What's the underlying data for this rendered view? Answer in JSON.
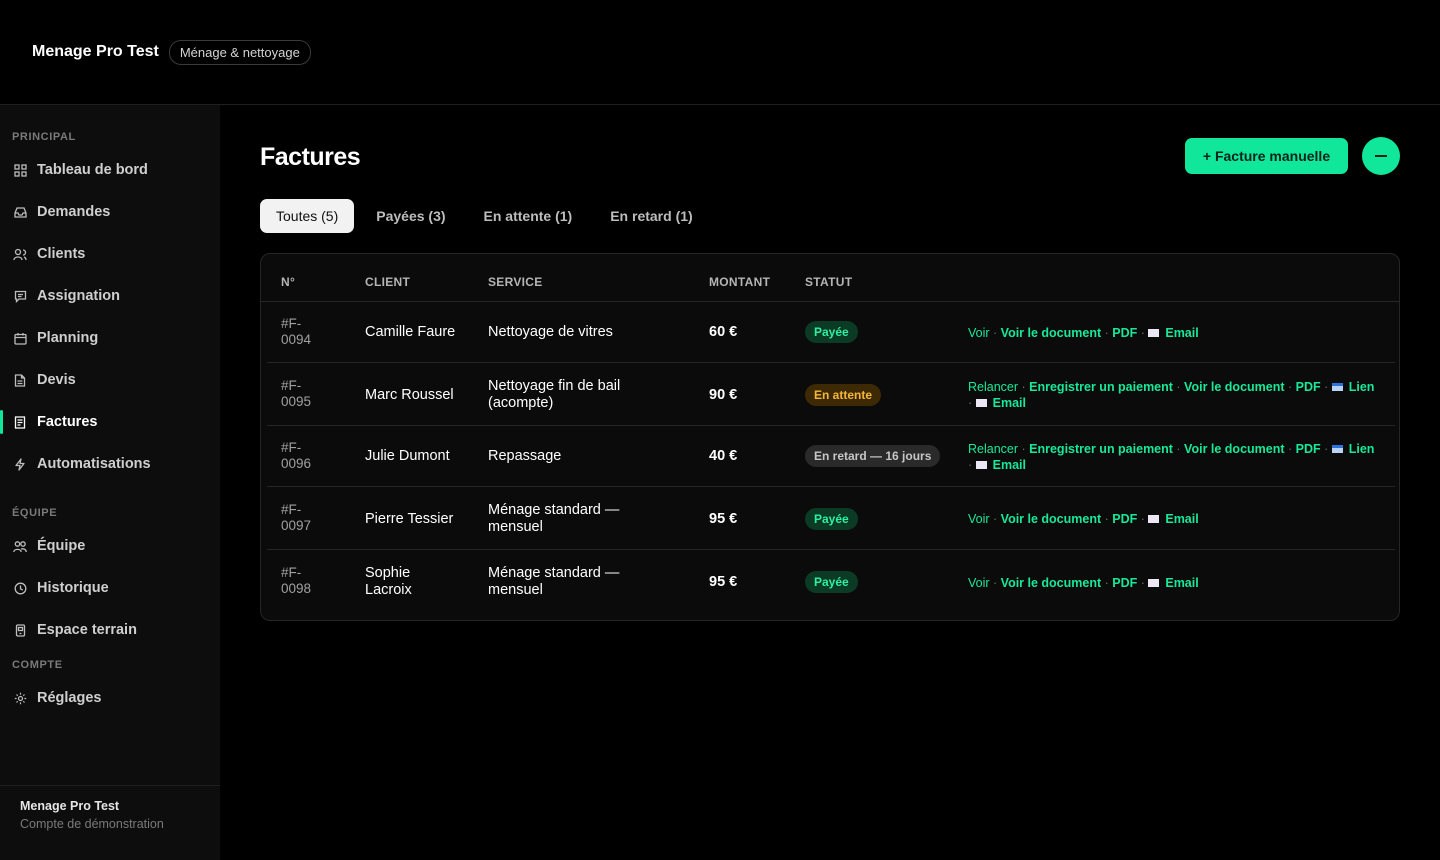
{
  "app": {
    "name": "Menage Pro Test",
    "tag": "Ménage & nettoyage"
  },
  "sidebar": {
    "sections": [
      {
        "label": "PRINCIPAL"
      },
      {
        "label": "ÉQUIPE"
      },
      {
        "label": "COMPTE"
      }
    ],
    "items": [
      {
        "label": "Tableau de bord",
        "icon": "grid-icon"
      },
      {
        "label": "Demandes",
        "icon": "inbox-icon"
      },
      {
        "label": "Clients",
        "icon": "users-icon"
      },
      {
        "label": "Assignation",
        "icon": "message-icon"
      },
      {
        "label": "Planning",
        "icon": "calendar-icon"
      },
      {
        "label": "Devis",
        "icon": "document-icon"
      },
      {
        "label": "Factures",
        "icon": "invoice-icon",
        "active": true
      },
      {
        "label": "Automatisations",
        "icon": "lightning-icon"
      },
      {
        "label": "Équipe",
        "icon": "team-icon"
      },
      {
        "label": "Historique",
        "icon": "clock-icon"
      },
      {
        "label": "Espace terrain",
        "icon": "mobile-icon"
      },
      {
        "label": "Réglages",
        "icon": "gear-icon"
      }
    ],
    "footer": {
      "name": "Menage Pro Test",
      "sub": "Compte de démonstration"
    }
  },
  "page": {
    "title": "Factures",
    "new_button": "+ Facture manuelle",
    "accent": "#10e79a"
  },
  "tabs": [
    {
      "label": "Toutes (5)",
      "active": true
    },
    {
      "label": "Payées (3)"
    },
    {
      "label": "En attente (1)"
    },
    {
      "label": "En retard (1)"
    }
  ],
  "table": {
    "headers": {
      "num": "N°",
      "client": "CLIENT",
      "service": "SERVICE",
      "amount": "MONTANT",
      "status": "STATUT"
    },
    "rows": [
      {
        "num1": "#F-",
        "num2": "0094",
        "client1": "Camille Faure",
        "client2": "",
        "service1": "Nettoyage de vitres",
        "service2": "",
        "amount": "60 €",
        "status": "Payée",
        "status_type": "paid",
        "a": [
          "Voir",
          "Voir le document",
          "PDF",
          "Email"
        ]
      },
      {
        "num1": "#F-",
        "num2": "0095",
        "client1": "Marc Roussel",
        "client2": "",
        "service1": "Nettoyage fin de bail",
        "service2": "(acompte)",
        "amount": "90 €",
        "status": "En attente",
        "status_type": "pending",
        "a": [
          "Relancer",
          "Enregistrer un paiement",
          "Voir le document",
          "PDF",
          "Lien",
          "Email"
        ]
      },
      {
        "num1": "#F-",
        "num2": "0096",
        "client1": "Julie Dumont",
        "client2": "",
        "service1": "Repassage",
        "service2": "",
        "amount": "40 €",
        "status": "En retard — 16 jours",
        "status_type": "late",
        "a": [
          "Relancer",
          "Enregistrer un paiement",
          "Voir le document",
          "PDF",
          "Lien",
          "Email"
        ]
      },
      {
        "num1": "#F-",
        "num2": "0097",
        "client1": "Pierre Tessier",
        "client2": "",
        "service1": "Ménage standard —",
        "service2": "mensuel",
        "amount": "95 €",
        "status": "Payée",
        "status_type": "paid",
        "a": [
          "Voir",
          "Voir le document",
          "PDF",
          "Email"
        ]
      },
      {
        "num1": "#F-",
        "num2": "0098",
        "client1": "Sophie",
        "client2": "Lacroix",
        "service1": "Ménage standard —",
        "service2": "mensuel",
        "amount": "95 €",
        "status": "Payée",
        "status_type": "paid",
        "a": [
          "Voir",
          "Voir le document",
          "PDF",
          "Email"
        ]
      }
    ]
  }
}
